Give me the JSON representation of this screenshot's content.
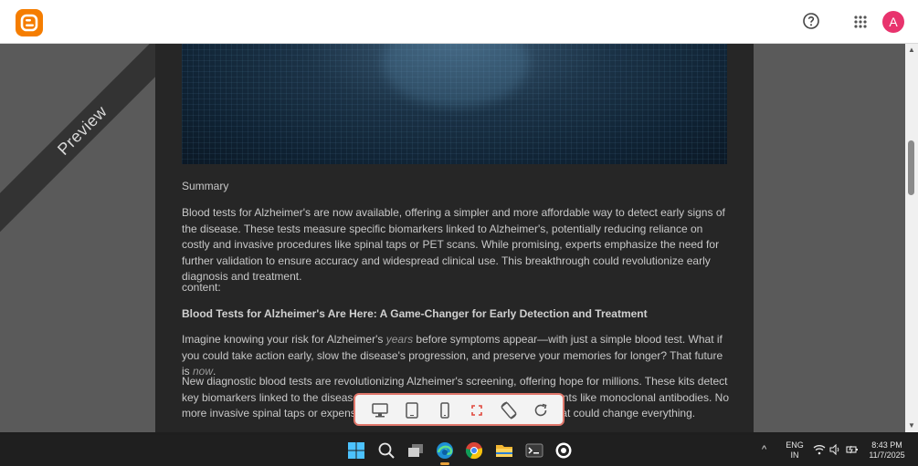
{
  "header": {
    "app_logo": "blogger-logo-icon",
    "help_icon": "help-circle-icon",
    "apps_icon": "apps-grid-icon",
    "avatar_letter": "A",
    "avatar_color": "#e8336d",
    "logo_color": "#f57d00"
  },
  "preview": {
    "ribbon_label": "Preview"
  },
  "article": {
    "summary_label": "Summary",
    "summary_text": "Blood tests for Alzheimer's are now available, offering a simpler and more affordable way to detect early signs of the disease. These tests measure specific biomarkers linked to Alzheimer's, potentially reducing reliance on costly and invasive procedures like spinal taps or PET scans. While promising, experts emphasize the need for further validation to ensure accuracy and widespread clinical use. This breakthrough could revolutionize early diagnosis and treatment.",
    "content_label": "content:",
    "title": "Blood Tests for Alzheimer's Are Here: A Game-Changer for Early Detection and Treatment",
    "para1_a": "Imagine knowing your risk for Alzheimer's ",
    "para1_em1": "years",
    "para1_b": " before symptoms appear—with just a simple blood test. What if you could take action early, slow the disease's progression, and preserve your memories for longer? That future is ",
    "para1_em2": "now",
    "para1_c": ".",
    "para2": "New diagnostic blood tests are revolutionizing Alzheimer's screening, offering hope for millions. These kits detect key biomarkers linked to the disease, enabling earlier intervention with treatments like monoclonal antibodies. No more invasive spinal taps or expensive scans—just a simple, affordable test that could change everything."
  },
  "device_toolbar": {
    "buttons": [
      "desktop-icon",
      "tablet-icon",
      "phone-icon",
      "fullscreen-icon",
      "rotate-icon",
      "refresh-icon"
    ]
  },
  "taskbar": {
    "apps": [
      "windows-start-icon",
      "search-icon",
      "task-view-icon",
      "edge-icon",
      "chrome-icon",
      "file-explorer-icon",
      "terminal-icon",
      "app-icon"
    ],
    "tray": {
      "language": "ENG",
      "region": "IN",
      "time": "8:43 PM",
      "date": "11/7/2025"
    }
  }
}
